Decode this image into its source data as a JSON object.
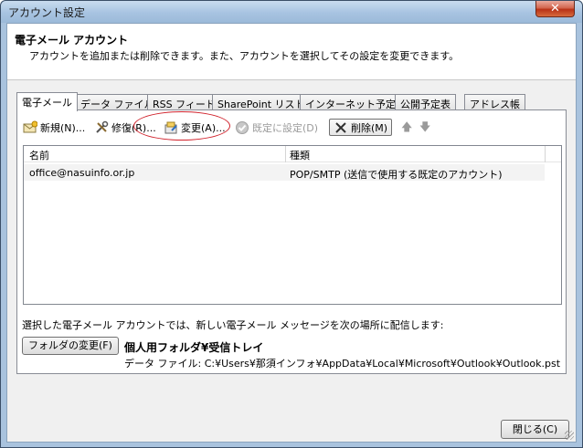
{
  "window": {
    "title": "アカウント設定",
    "close_glyph": "✕"
  },
  "header": {
    "title": "電子メール アカウント",
    "description": "アカウントを追加または削除できます。また、アカウントを選択してその設定を変更できます。"
  },
  "tabs": [
    {
      "label": "電子メール",
      "active": true
    },
    {
      "label": "データ ファイル",
      "active": false
    },
    {
      "label": "RSS フィード",
      "active": false
    },
    {
      "label": "SharePoint リスト",
      "active": false
    },
    {
      "label": "インターネット予定表",
      "active": false
    },
    {
      "label": "公開予定表",
      "active": false
    },
    {
      "label": "アドレス帳",
      "active": false
    }
  ],
  "toolbar": {
    "new_label": "新規(N)...",
    "repair_label": "修復(R)...",
    "change_label": "変更(A)...",
    "default_label": "既定に設定(D)",
    "delete_label": "削除(M)",
    "up_glyph": "🡅",
    "down_glyph": "🡇"
  },
  "account_list": {
    "columns": [
      "名前",
      "種類"
    ],
    "rows": [
      {
        "name": "office@nasuinfo.or.jp",
        "type": "POP/SMTP (送信で使用する既定のアカウント)"
      }
    ]
  },
  "delivery": {
    "description": "選択した電子メール アカウントでは、新しい電子メール メッセージを次の場所に配信します:",
    "change_folder_label": "フォルダの変更(F)",
    "folder_name": "個人用フォルダ¥受信トレイ",
    "data_file": "データ ファイル: C:¥Users¥那須インフォ¥AppData¥Local¥Microsoft¥Outlook¥Outlook.pst"
  },
  "footer": {
    "close_label": "閉じる(C)"
  },
  "colors": {
    "highlight_ellipse": "#d0202a",
    "title_close": "#c8452b"
  }
}
